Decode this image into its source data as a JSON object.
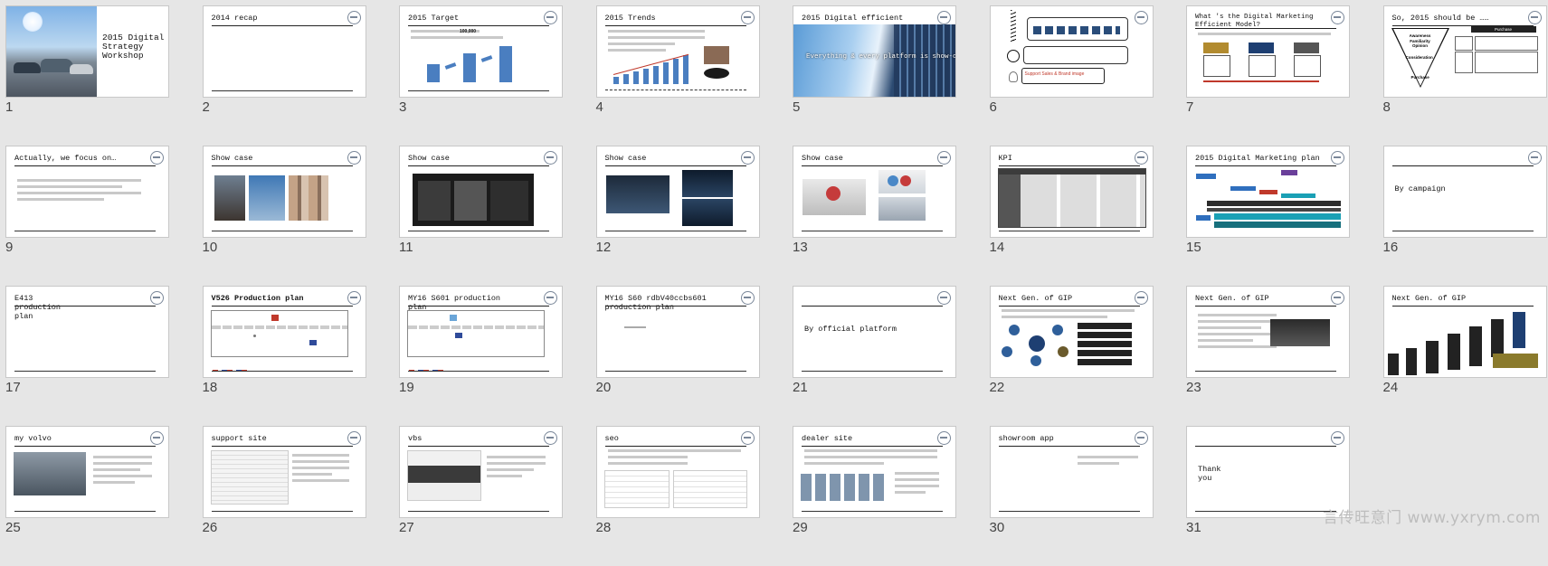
{
  "slides": [
    {
      "n": "1",
      "title": "2015 Digital Strategy Workshop"
    },
    {
      "n": "2",
      "title": "2014 recap"
    },
    {
      "n": "3",
      "title": "2015 Target",
      "value": "100,000"
    },
    {
      "n": "4",
      "title": "2015 Trends"
    },
    {
      "n": "5",
      "title": "2015 Digital efficient",
      "overlay": "Everything & every platform is show-case"
    },
    {
      "n": "6",
      "title": "",
      "support": "Support Sales & Brand image"
    },
    {
      "n": "7",
      "title": "What 's the Digital Marketing Efficient Model?"
    },
    {
      "n": "8",
      "title": "So, 2015 should be ……",
      "funnel_top": "Awareness Familiarity Opinion",
      "funnel_mid": "Consideration",
      "funnel_bot": "Purchase",
      "box_title": "Purchase"
    },
    {
      "n": "9",
      "title": "Actually, we focus on…"
    },
    {
      "n": "10",
      "title": "Show case"
    },
    {
      "n": "11",
      "title": "Show case"
    },
    {
      "n": "12",
      "title": "Show case"
    },
    {
      "n": "13",
      "title": "Show case"
    },
    {
      "n": "14",
      "title": "KPI"
    },
    {
      "n": "15",
      "title": "2015 Digital Marketing plan"
    },
    {
      "n": "16",
      "title": "",
      "label": "By campaign"
    },
    {
      "n": "17",
      "title": "E413 production plan"
    },
    {
      "n": "18",
      "title": "V526 Production plan"
    },
    {
      "n": "19",
      "title": "MY16 S601 production plan"
    },
    {
      "n": "20",
      "title": "MY16 S60 rdbV40ccbs601 production plan"
    },
    {
      "n": "21",
      "title": "",
      "label": "By official platform"
    },
    {
      "n": "22",
      "title": "Next Gen. of GIP"
    },
    {
      "n": "23",
      "title": "Next Gen. of GIP"
    },
    {
      "n": "24",
      "title": "Next Gen. of GIP"
    },
    {
      "n": "25",
      "title": "my volvo"
    },
    {
      "n": "26",
      "title": "support site"
    },
    {
      "n": "27",
      "title": "vbs"
    },
    {
      "n": "28",
      "title": "seo"
    },
    {
      "n": "29",
      "title": "dealer site"
    },
    {
      "n": "30",
      "title": "showroom app"
    },
    {
      "n": "31",
      "title": "",
      "label": "Thank you"
    }
  ],
  "watermark": "言传旺意门 www.yxrym.com"
}
